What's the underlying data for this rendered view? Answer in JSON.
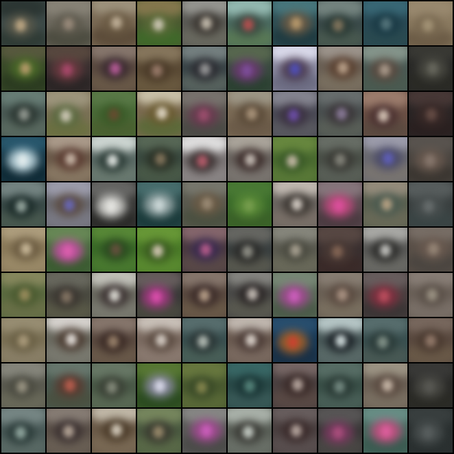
{
  "grid": {
    "rows": 10,
    "cols": 10,
    "border_color": "#000000",
    "tiles": [
      [
        {
          "bg": "#3d4a48",
          "top": "#2a3431",
          "mid": "#5b5a4c",
          "low": "#2e3a34",
          "spot": "#c9b08a"
        },
        {
          "bg": "#6e6a5f",
          "top": "#8a8579",
          "mid": "#5e5a4e",
          "low": "#4a4a3e",
          "spot": "#a09080"
        },
        {
          "bg": "#7a6a55",
          "top": "#a09580",
          "mid": "#6b5b44",
          "low": "#5a4a38",
          "spot": "#c8b8a0"
        },
        {
          "bg": "#4a5a30",
          "top": "#8a7a50",
          "mid": "#5a6a38",
          "low": "#3f6a2a",
          "spot": "#d8d0c0"
        },
        {
          "bg": "#5a5a55",
          "top": "#9a9a95",
          "mid": "#3a3530",
          "low": "#6a6a60",
          "spot": "#d0c8b8"
        },
        {
          "bg": "#4a6a60",
          "top": "#9ac0b8",
          "mid": "#3a4a42",
          "low": "#5a7a55",
          "spot": "#c05050"
        },
        {
          "bg": "#2f4f55",
          "top": "#4a7a80",
          "mid": "#6a5a45",
          "low": "#1f3a40",
          "spot": "#c0a070"
        },
        {
          "bg": "#3a4a4a",
          "top": "#7a8a85",
          "mid": "#2a3a35",
          "low": "#4a5a50",
          "spot": "#8a7a60"
        },
        {
          "bg": "#2a4a55",
          "top": "#3a6a78",
          "mid": "#1a3a45",
          "low": "#2a4a50",
          "spot": "#5a7a80"
        },
        {
          "bg": "#8a7a60",
          "top": "#9a8a70",
          "mid": "#7a6a52",
          "low": "#6a5a45",
          "spot": "#a8987a"
        }
      ],
      [
        {
          "bg": "#3a4a2a",
          "top": "#5a5a40",
          "mid": "#4a6a28",
          "low": "#2a3a20",
          "spot": "#c0a070"
        },
        {
          "bg": "#3a3030",
          "top": "#5a4a40",
          "mid": "#6a3a40",
          "low": "#2a2525",
          "spot": "#b04a70"
        },
        {
          "bg": "#5a4a40",
          "top": "#8a7a70",
          "mid": "#3a2a30",
          "low": "#6a5a48",
          "spot": "#c060a0"
        },
        {
          "bg": "#5a4a35",
          "top": "#8a7a60",
          "mid": "#4a3a28",
          "low": "#6a5a40",
          "spot": "#a08070"
        },
        {
          "bg": "#3a4548",
          "top": "#7a8585",
          "mid": "#2a2a30",
          "low": "#5a6560",
          "spot": "#a0a0a0"
        },
        {
          "bg": "#3a4a40",
          "top": "#5a6a50",
          "mid": "#6a3a70",
          "low": "#2a4030",
          "spot": "#8050a0"
        },
        {
          "bg": "#8a8aa0",
          "top": "#e0e0f0",
          "mid": "#4a3a50",
          "low": "#6a6a80",
          "spot": "#5050c0"
        },
        {
          "bg": "#6a6055",
          "top": "#a09890",
          "mid": "#5a4030",
          "low": "#7a7060",
          "spot": "#c0a890"
        },
        {
          "bg": "#4a5a55",
          "top": "#8a9a90",
          "mid": "#5a4a40",
          "low": "#4a5a50",
          "spot": "#b0a090"
        },
        {
          "bg": "#2a2a28",
          "top": "#3a3a35",
          "mid": "#4a4a42",
          "low": "#2a2a25",
          "spot": "#6a6a60"
        }
      ],
      [
        {
          "bg": "#4a5a55",
          "top": "#6a8078",
          "mid": "#2a3530",
          "low": "#5a6a60",
          "spot": "#9aa098"
        },
        {
          "bg": "#7a7055",
          "top": "#a09880",
          "mid": "#5a6a40",
          "low": "#6a7040",
          "spot": "#d8d0c0"
        },
        {
          "bg": "#4a6a38",
          "top": "#5a7a48",
          "mid": "#3a5a28",
          "low": "#4a6030",
          "spot": "#6a4a30"
        },
        {
          "bg": "#7a6a50",
          "top": "#d0c8b0",
          "mid": "#6a5a30",
          "low": "#5a6a38",
          "spot": "#e8e0d0"
        },
        {
          "bg": "#5a5550",
          "top": "#7a7570",
          "mid": "#6a3a50",
          "low": "#4a4a45",
          "spot": "#a05070"
        },
        {
          "bg": "#7a6a55",
          "top": "#a09a8a",
          "mid": "#5a4a38",
          "low": "#6a5a48",
          "spot": "#b09a80"
        },
        {
          "bg": "#4a4a55",
          "top": "#8a8a95",
          "mid": "#3a3040",
          "low": "#5a5a60",
          "spot": "#7050b0"
        },
        {
          "bg": "#4a5050",
          "top": "#6a7070",
          "mid": "#3a3538",
          "low": "#5a6058",
          "spot": "#9080a0"
        },
        {
          "bg": "#6a5045",
          "top": "#a08070",
          "mid": "#4a3030",
          "low": "#5a4a40",
          "spot": "#e0d0c0"
        },
        {
          "bg": "#2a2525",
          "top": "#4a3a38",
          "mid": "#3a2a28",
          "low": "#2a2020",
          "spot": "#6a5048"
        }
      ],
      [
        {
          "bg": "#1a3a48",
          "top": "#2a5a70",
          "mid": "#c0d8e0",
          "low": "#0f2a35",
          "spot": "#e8f0f0"
        },
        {
          "bg": "#6a5a4a",
          "top": "#b0a090",
          "mid": "#5a3a30",
          "low": "#8a7a65",
          "spot": "#d0c0b0"
        },
        {
          "bg": "#5a6a65",
          "top": "#d8e0dc",
          "mid": "#2a3a35",
          "low": "#6a7a70",
          "spot": "#f0f4f0"
        },
        {
          "bg": "#3a4a40",
          "top": "#5a6a58",
          "mid": "#2a3025",
          "low": "#4a5a48",
          "spot": "#8a7a60"
        },
        {
          "bg": "#7a7575",
          "top": "#e8e8e8",
          "mid": "#3a3030",
          "low": "#8a8585",
          "spot": "#c06070"
        },
        {
          "bg": "#6a6560",
          "top": "#b0aaa0",
          "mid": "#3a2a28",
          "low": "#7a7570",
          "spot": "#d0c8c0"
        },
        {
          "bg": "#4a6a30",
          "top": "#6a8a40",
          "mid": "#3a5a28",
          "low": "#5a7a38",
          "spot": "#d0c0b0"
        },
        {
          "bg": "#4a5048",
          "top": "#6a7068",
          "mid": "#3a3a35",
          "low": "#5a6058",
          "spot": "#8a8a80"
        },
        {
          "bg": "#6a6a70",
          "top": "#a0a0b0",
          "mid": "#4a4a68",
          "low": "#7a7570",
          "spot": "#6060c0"
        },
        {
          "bg": "#4a4540",
          "top": "#5a5550",
          "mid": "#6a5a50",
          "low": "#3a3530",
          "spot": "#8a7a70"
        }
      ],
      [
        {
          "bg": "#3a4a48",
          "top": "#7a8a88",
          "mid": "#1a2a28",
          "low": "#4a5a50",
          "spot": "#a0b0a8"
        },
        {
          "bg": "#6a6a70",
          "top": "#a0a0b0",
          "mid": "#5a4a40",
          "low": "#7a7a85",
          "spot": "#6a6ac0"
        },
        {
          "bg": "#3a3a38",
          "top": "#6a6a68",
          "mid": "#d0d0cc",
          "low": "#2a2a28",
          "spot": "#e8e8e4"
        },
        {
          "bg": "#2a4a4a",
          "top": "#4a7070",
          "mid": "#a0b0b0",
          "low": "#1a3a3a",
          "spot": "#d0dcdc"
        },
        {
          "bg": "#5a5a50",
          "top": "#7a7a70",
          "mid": "#6a5a45",
          "low": "#4a5040",
          "spot": "#a0907a"
        },
        {
          "bg": "#3a6a2a",
          "top": "#4a7a35",
          "mid": "#5a8a38",
          "low": "#3a6028",
          "spot": "#7aa050"
        },
        {
          "bg": "#6a6560",
          "top": "#c8c0b8",
          "mid": "#3a3530",
          "low": "#7a7068",
          "spot": "#e0d8d0"
        },
        {
          "bg": "#5a4a50",
          "top": "#8a7a80",
          "mid": "#c04a80",
          "low": "#4a3a40",
          "spot": "#e050a0"
        },
        {
          "bg": "#5a6050",
          "top": "#9a9080",
          "mid": "#4a5a50",
          "low": "#6a6a58",
          "spot": "#c0a888"
        },
        {
          "bg": "#3a4040",
          "top": "#5a6060",
          "mid": "#4a5050",
          "low": "#3a4545",
          "spot": "#6a7070"
        }
      ],
      [
        {
          "bg": "#8a7a5a",
          "top": "#b0a080",
          "mid": "#6a5a40",
          "low": "#9a8a68",
          "spot": "#d0c0a0"
        },
        {
          "bg": "#4a6a40",
          "top": "#6a8a58",
          "mid": "#c050a0",
          "low": "#3a5a30",
          "spot": "#e060b0"
        },
        {
          "bg": "#3a6a28",
          "top": "#5a8a38",
          "mid": "#2a4a20",
          "low": "#4a7a30",
          "spot": "#6a5040"
        },
        {
          "bg": "#4a7a28",
          "top": "#6a9a38",
          "mid": "#3a5a20",
          "low": "#5a8a30",
          "spot": "#e0d0c0"
        },
        {
          "bg": "#4a3a40",
          "top": "#8a6a70",
          "mid": "#3a2a50",
          "low": "#5a4a48",
          "spot": "#c06090"
        },
        {
          "bg": "#3a4040",
          "top": "#6a6a65",
          "mid": "#2a2a28",
          "low": "#5a5a50",
          "spot": "#9a9a90"
        },
        {
          "bg": "#5a5a50",
          "top": "#8a8a80",
          "mid": "#4a4a40",
          "low": "#6a6a5a",
          "spot": "#b0a898"
        },
        {
          "bg": "#3a3030",
          "top": "#5a4a45",
          "mid": "#4a3a35",
          "low": "#3a2a28",
          "spot": "#8a6a58"
        },
        {
          "bg": "#5a5a58",
          "top": "#b0b0ac",
          "mid": "#2a2a28",
          "low": "#6a6a65",
          "spot": "#d0d0cc"
        },
        {
          "bg": "#5a5048",
          "top": "#7a7068",
          "mid": "#6a5a50",
          "low": "#4a4540",
          "spot": "#9a8a7a"
        }
      ],
      [
        {
          "bg": "#5a6a40",
          "top": "#8a8a60",
          "mid": "#4a5a30",
          "low": "#6a7048",
          "spot": "#a09060"
        },
        {
          "bg": "#4a4a40",
          "top": "#6a6a60",
          "mid": "#3a3530",
          "low": "#5a5a48",
          "spot": "#8a7a68"
        },
        {
          "bg": "#6a6a60",
          "top": "#c8c8c0",
          "mid": "#3a3030",
          "low": "#7a7a70",
          "spot": "#e8e8e0"
        },
        {
          "bg": "#3a3a38",
          "top": "#6a6060",
          "mid": "#a03a80",
          "low": "#4a4a40",
          "spot": "#e050b0"
        },
        {
          "bg": "#5a4a40",
          "top": "#8a7a70",
          "mid": "#3a2a28",
          "low": "#6a5a48",
          "spot": "#c0a890"
        },
        {
          "bg": "#4a4a48",
          "top": "#8a8a85",
          "mid": "#2a2525",
          "low": "#5a5a50",
          "spot": "#d0c8c0"
        },
        {
          "bg": "#5a6a58",
          "top": "#7a8a78",
          "mid": "#a04a90",
          "low": "#4a5a48",
          "spot": "#d060c0"
        },
        {
          "bg": "#6a6055",
          "top": "#8a8075",
          "mid": "#5a4a40",
          "low": "#7a7060",
          "spot": "#b09888"
        },
        {
          "bg": "#4a4040",
          "top": "#6a6060",
          "mid": "#803040",
          "low": "#3a3535",
          "spot": "#c05060"
        },
        {
          "bg": "#6a6058",
          "top": "#8a8078",
          "mid": "#5a5048",
          "low": "#7a7068",
          "spot": "#a09888"
        }
      ],
      [
        {
          "bg": "#7a7055",
          "top": "#9a9075",
          "mid": "#6a6045",
          "low": "#8a8068",
          "spot": "#b0a080"
        },
        {
          "bg": "#6a6a60",
          "top": "#e0dcd8",
          "mid": "#4a3a30",
          "low": "#7a7a70",
          "spot": "#f0ece8"
        },
        {
          "bg": "#5a4a40",
          "top": "#8a7a70",
          "mid": "#3a2a25",
          "low": "#6a5a4a",
          "spot": "#a08870"
        },
        {
          "bg": "#7a6a60",
          "top": "#d0c8c0",
          "mid": "#5a4a40",
          "low": "#8a7a70",
          "spot": "#e0d8d0"
        },
        {
          "bg": "#3a5050",
          "top": "#5a7070",
          "mid": "#2a3535",
          "low": "#4a6058",
          "spot": "#c0c8c0"
        },
        {
          "bg": "#6a5a50",
          "top": "#c8c0b8",
          "mid": "#4a3a35",
          "low": "#7a6a60",
          "spot": "#e8e0d8"
        },
        {
          "bg": "#1a3a55",
          "top": "#2a5070",
          "mid": "#a0602a",
          "low": "#1a3045",
          "spot": "#d04030"
        },
        {
          "bg": "#4a5a5a",
          "top": "#c0d0d0",
          "mid": "#1a2025",
          "low": "#5a6a68",
          "spot": "#e0ecec"
        },
        {
          "bg": "#3a5050",
          "top": "#5a7070",
          "mid": "#2a3a38",
          "low": "#4a5a55",
          "spot": "#8a9a90"
        },
        {
          "bg": "#5a4a40",
          "top": "#7a6a60",
          "mid": "#4a3a30",
          "low": "#6a5a48",
          "spot": "#9a8070"
        }
      ],
      [
        {
          "bg": "#5a5a50",
          "top": "#8a8a80",
          "mid": "#4a4a40",
          "low": "#6a6a5a",
          "spot": "#a09a88"
        },
        {
          "bg": "#4a5a50",
          "top": "#6a7a70",
          "mid": "#5a3a30",
          "low": "#4a5040",
          "spot": "#c06050"
        },
        {
          "bg": "#4a5a48",
          "top": "#6a7a68",
          "mid": "#3a4035",
          "low": "#5a6a55",
          "spot": "#8a9080"
        },
        {
          "bg": "#3a5a25",
          "top": "#5a7a35",
          "mid": "#8a8aa0",
          "low": "#2a4a20",
          "spot": "#e0e0f0"
        },
        {
          "bg": "#4a5a30",
          "top": "#6a7a40",
          "mid": "#3a4a28",
          "low": "#5a6a38",
          "spot": "#8a8a50"
        },
        {
          "bg": "#2a4a48",
          "top": "#3a6a68",
          "mid": "#1a3535",
          "low": "#3a5a58",
          "spot": "#5a8a80"
        },
        {
          "bg": "#4a4040",
          "top": "#7a6a68",
          "mid": "#3a2a28",
          "low": "#5a4a45",
          "spot": "#c0b0a8"
        },
        {
          "bg": "#3a5048",
          "top": "#5a7068",
          "mid": "#2a3a35",
          "low": "#4a6058",
          "spot": "#7a9088"
        },
        {
          "bg": "#6a6055",
          "top": "#a09888",
          "mid": "#5a4a40",
          "low": "#7a7062",
          "spot": "#d0c0b0"
        },
        {
          "bg": "#2a2a28",
          "top": "#3a3a38",
          "mid": "#4a4a45",
          "low": "#2a2a25",
          "spot": "#5a5a55"
        }
      ],
      [
        {
          "bg": "#4a5a58",
          "top": "#7a8a88",
          "mid": "#2a3a38",
          "low": "#5a6a65",
          "spot": "#9ab0a8"
        },
        {
          "bg": "#5a5048",
          "top": "#8a8078",
          "mid": "#3a3030",
          "low": "#6a6055",
          "spot": "#c0b0a0"
        },
        {
          "bg": "#6a5a48",
          "top": "#c8c0b0",
          "mid": "#4a3a28",
          "low": "#7a6a55",
          "spot": "#e0d8c8"
        },
        {
          "bg": "#4a5a40",
          "top": "#7a8a60",
          "mid": "#3a3a30",
          "low": "#5a6a48",
          "spot": "#a09070"
        },
        {
          "bg": "#5a5a58",
          "top": "#8a8a88",
          "mid": "#a04a90",
          "low": "#4a4a48",
          "spot": "#d060c0"
        },
        {
          "bg": "#5a6058",
          "top": "#b0b8b0",
          "mid": "#3a3a35",
          "low": "#6a7068",
          "spot": "#d0d8d0"
        },
        {
          "bg": "#4a4040",
          "top": "#6a6060",
          "mid": "#3a2a2a",
          "low": "#5a5050",
          "spot": "#c0b0a8"
        },
        {
          "bg": "#3a3838",
          "top": "#5a5858",
          "mid": "#7a3a60",
          "low": "#4a4845",
          "spot": "#b05080"
        },
        {
          "bg": "#4a6a60",
          "top": "#6a9088",
          "mid": "#c05080",
          "low": "#3a5a50",
          "spot": "#e060a0"
        },
        {
          "bg": "#2a3030",
          "top": "#3a4040",
          "mid": "#4a5050",
          "low": "#2a3030",
          "spot": "#5a6060"
        }
      ]
    ]
  }
}
